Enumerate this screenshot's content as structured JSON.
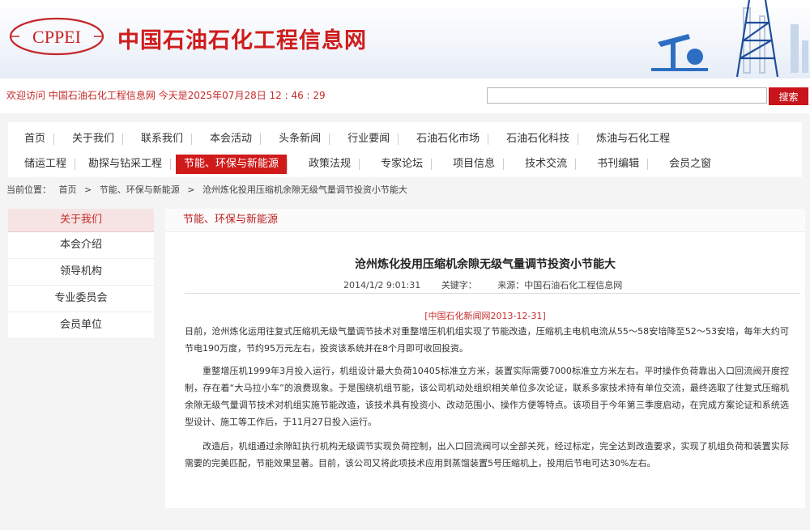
{
  "header": {
    "logo_text": "CPPEI",
    "site_name": "中国石油石化工程信息网"
  },
  "welcome": "欢迎访问 中国石油石化工程信息网 今天是2025年07月28日 12 : 46 : 29",
  "search": {
    "placeholder": "",
    "button": "搜索"
  },
  "nav": {
    "row1": [
      "首页",
      "关于我们",
      "联系我们",
      "本会活动",
      "头条新闻",
      "行业要闻",
      "石油石化市场",
      "石油石化科技",
      "炼油与石化工程"
    ],
    "row2": [
      "储运工程",
      "勘探与钻采工程",
      "节能、环保与新能源",
      "政策法规",
      "专家论坛",
      "项目信息",
      "技术交流",
      "书刊编辑",
      "会员之窗"
    ],
    "active": "节能、环保与新能源"
  },
  "breadcrumb": [
    "当前位置：",
    "首页",
    ">",
    "节能、环保与新能源",
    ">",
    "沧州炼化投用压缩机余隙无级气量调节投资小节能大"
  ],
  "sidebar": {
    "title": "关于我们",
    "items": [
      "本会介绍",
      "领导机构",
      "专业委员会",
      "会员单位"
    ]
  },
  "main": {
    "section_title": "节能、环保与新能源",
    "article": {
      "title": "沧州炼化投用压缩机余隙无级气量调节投资小节能大",
      "date": "2014/1/2 9:01:31",
      "keywords_label": "关键字：",
      "source": "来源：中国石油石化工程信息网",
      "source_tag": "[中国石化新闻网2013-12-31]",
      "paragraphs": [
        "日前，沧州炼化运用往复式压缩机无级气量调节技术对重整增压机机组实现了节能改造，压缩机主电机电流从55～58安培降至52～53安培，每年大约可节电190万度，节约95万元左右，投资该系统并在8个月即可收回投资。",
        "重整增压机1999年3月投入运行，机组设计最大负荷10405标准立方米，装置实际需要7000标准立方米左右。平时操作负荷靠出入口回流阀开度控制，存在着“大马拉小车”的浪费现象。于是围绕机组节能，该公司机动处组织相关单位多次论证，联系多家技术持有单位交流，最终选取了往复式压缩机余隙无级气量调节技术对机组实施节能改造，该技术具有投资小、改动范围小、操作方便等特点。该项目于今年第三季度启动，在完成方案论证和系统选型设计、施工等工作后，于11月27日投入运行。",
        "改造后，机组通过余隙缸执行机构无级调节实现负荷控制，出入口回流阀可以全部关死，经过标定，完全达到改造要求，实现了机组负荷和装置实际需要的完美匹配，节能效果显著。目前，该公司又将此项技术应用到蒸馏装置5号压缩机上，投用后节电可达30%左右。"
      ]
    }
  },
  "colors": {
    "brand_red": "#c8141a",
    "title_red": "#cf1c1c",
    "logo_red": "#c4262a"
  }
}
